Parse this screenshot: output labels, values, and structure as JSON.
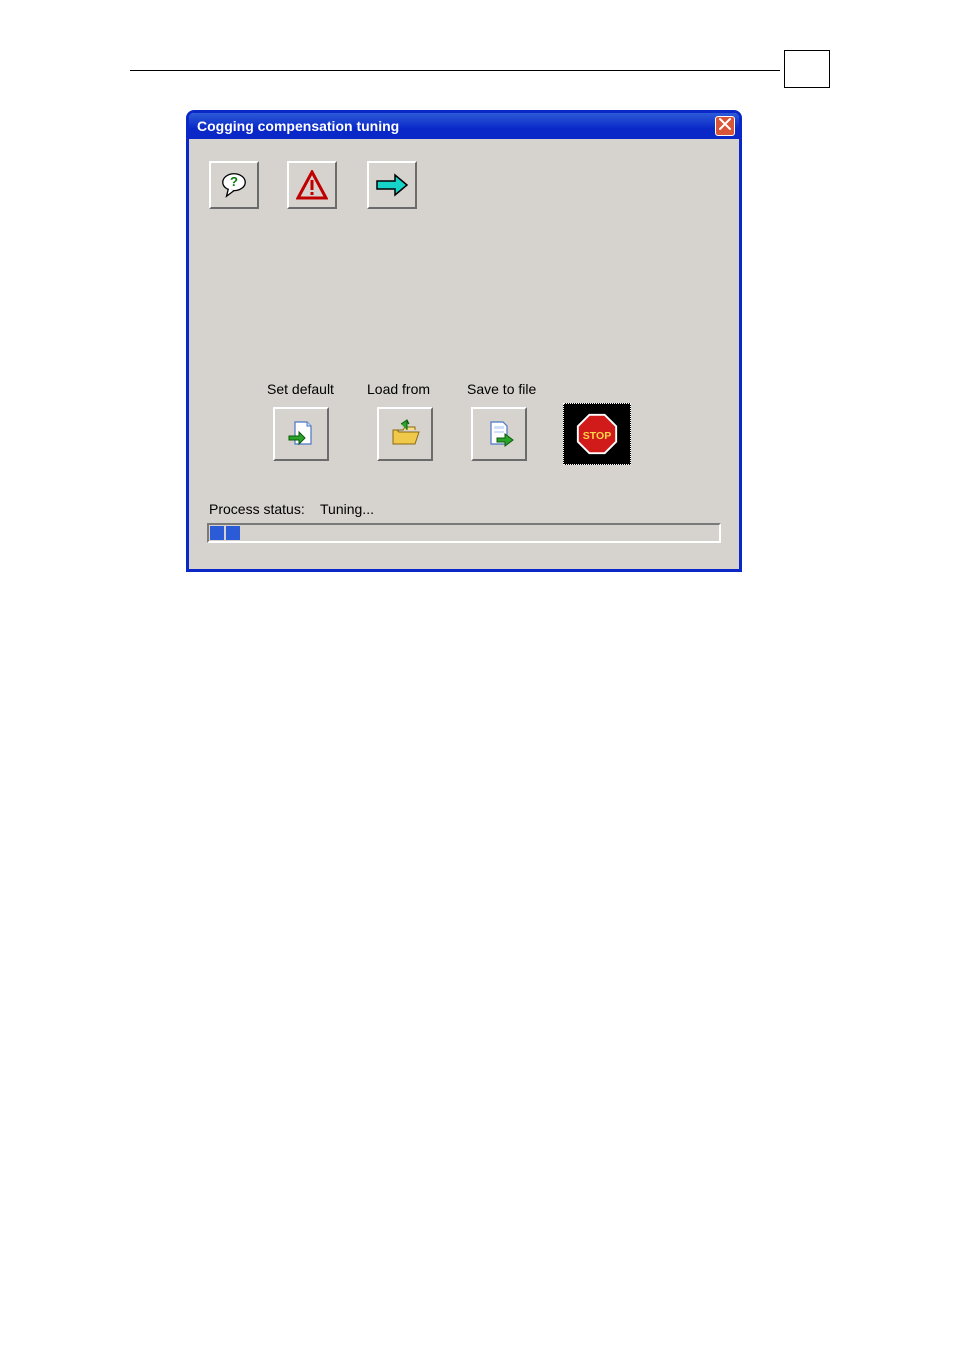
{
  "window": {
    "title": "Cogging compensation tuning"
  },
  "toolbar": {
    "help_icon": "help-balloon-icon",
    "warn_icon": "warning-triangle-icon",
    "arrow_icon": "arrow-right-icon"
  },
  "labels": {
    "set_default": "Set default",
    "load_from": "Load from",
    "save_to_file": "Save to file"
  },
  "buttons": {
    "stop_label": "STOP"
  },
  "status": {
    "label": "Process status:",
    "value": "Tuning...",
    "segments": 2
  }
}
